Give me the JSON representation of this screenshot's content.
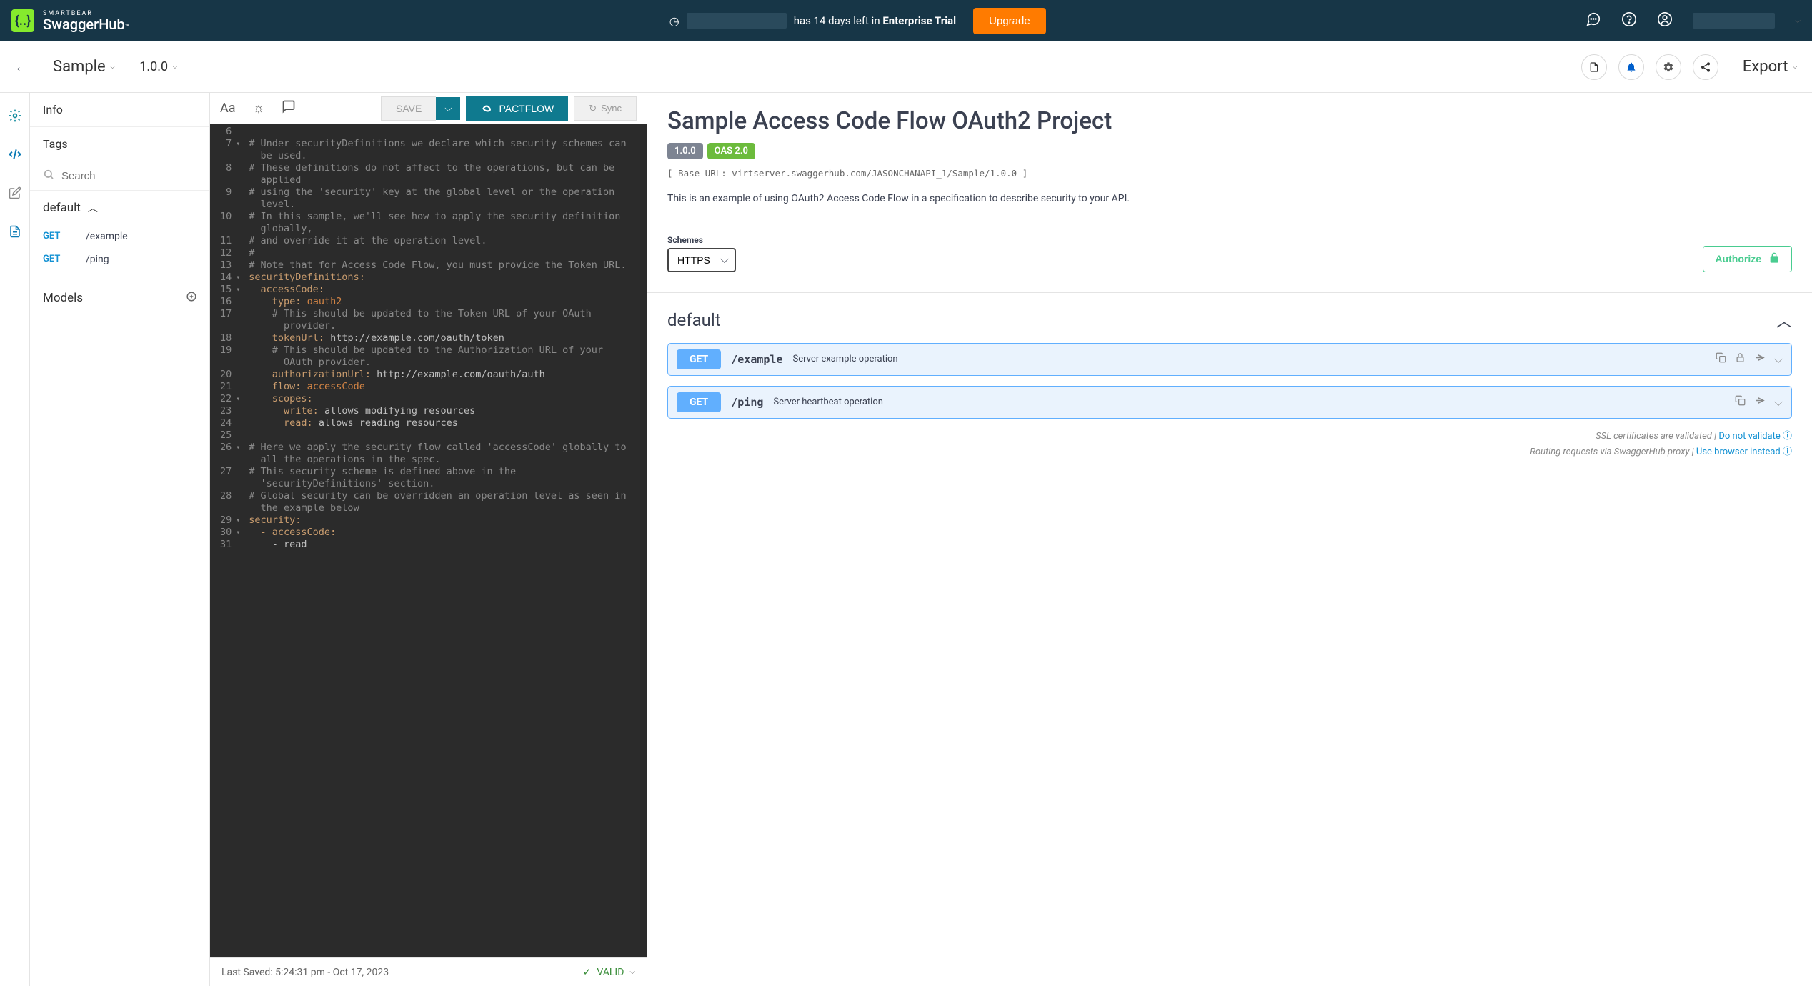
{
  "header": {
    "brand_small": "SMARTBEAR",
    "brand_big": "SwaggerHub",
    "trial_prefix": "has 14 days left in ",
    "trial_bold": "Enterprise Trial",
    "upgrade": "Upgrade"
  },
  "subheader": {
    "api_name": "Sample",
    "version": "1.0.0",
    "export": "Export"
  },
  "nav": {
    "info": "Info",
    "tags": "Tags",
    "search_placeholder": "Search",
    "group": "default",
    "endpoints": [
      {
        "method": "GET",
        "path": "/example"
      },
      {
        "method": "GET",
        "path": "/ping"
      }
    ],
    "models": "Models"
  },
  "editor_toolbar": {
    "save": "SAVE",
    "pactflow": "PACTFLOW",
    "sync": "Sync"
  },
  "editor_lines": [
    {
      "n": 6,
      "fold": false,
      "html": ""
    },
    {
      "n": 7,
      "fold": true,
      "html": "<span class='c-comment'># Under securityDefinitions we declare which security schemes can</span>"
    },
    {
      "n": "",
      "fold": false,
      "html": "<span class='c-comment'>  be used.</span>"
    },
    {
      "n": 8,
      "fold": false,
      "html": "<span class='c-comment'># These definitions do not affect to the operations, but can be</span>"
    },
    {
      "n": "",
      "fold": false,
      "html": "<span class='c-comment'>  applied</span>"
    },
    {
      "n": 9,
      "fold": false,
      "html": "<span class='c-comment'># using the 'security' key at the global level or the operation</span>"
    },
    {
      "n": "",
      "fold": false,
      "html": "<span class='c-comment'>  level.</span>"
    },
    {
      "n": 10,
      "fold": false,
      "html": "<span class='c-comment'># In this sample, we'll see how to apply the security definition</span>"
    },
    {
      "n": "",
      "fold": false,
      "html": "<span class='c-comment'>  globally,</span>"
    },
    {
      "n": 11,
      "fold": false,
      "html": "<span class='c-comment'># and override it at the operation level.</span>"
    },
    {
      "n": 12,
      "fold": false,
      "html": "<span class='c-comment'>#</span>"
    },
    {
      "n": 13,
      "fold": false,
      "html": "<span class='c-comment'># Note that for Access Code Flow, you must provide the Token URL.</span>"
    },
    {
      "n": 14,
      "fold": true,
      "html": "<span class='c-key'>securityDefinitions:</span>"
    },
    {
      "n": 15,
      "fold": true,
      "html": "  <span class='c-key'>accessCode:</span>"
    },
    {
      "n": 16,
      "fold": false,
      "html": "    <span class='c-key'>type:</span> <span class='c-keyword'>oauth2</span>"
    },
    {
      "n": 17,
      "fold": false,
      "html": "    <span class='c-comment'># This should be updated to the Token URL of your OAuth</span>"
    },
    {
      "n": "",
      "fold": false,
      "html": "    <span class='c-comment'>  provider.</span>"
    },
    {
      "n": 18,
      "fold": false,
      "html": "    <span class='c-key'>tokenUrl:</span> <span class='c-val'>http://example.com/oauth/token</span>"
    },
    {
      "n": 19,
      "fold": false,
      "html": "    <span class='c-comment'># This should be updated to the Authorization URL of your</span>"
    },
    {
      "n": "",
      "fold": false,
      "html": "    <span class='c-comment'>  OAuth provider.</span>"
    },
    {
      "n": 20,
      "fold": false,
      "html": "    <span class='c-key'>authorizationUrl:</span> <span class='c-val'>http://example.com/oauth/auth</span>"
    },
    {
      "n": 21,
      "fold": false,
      "html": "    <span class='c-key'>flow:</span> <span class='c-keyword'>accessCode</span>"
    },
    {
      "n": 22,
      "fold": true,
      "html": "    <span class='c-key'>scopes:</span>"
    },
    {
      "n": 23,
      "fold": false,
      "html": "      <span class='c-key'>write:</span> <span class='c-val'>allows modifying resources</span>"
    },
    {
      "n": 24,
      "fold": false,
      "html": "      <span class='c-key'>read:</span> <span class='c-val'>allows reading resources</span>"
    },
    {
      "n": 25,
      "fold": false,
      "html": ""
    },
    {
      "n": 26,
      "fold": true,
      "html": "<span class='c-comment'># Here we apply the security flow called 'accessCode' globally to</span>"
    },
    {
      "n": "",
      "fold": false,
      "html": "<span class='c-comment'>  all the operations in the spec.</span>"
    },
    {
      "n": 27,
      "fold": false,
      "html": "<span class='c-comment'># This security scheme is defined above in the</span>"
    },
    {
      "n": "",
      "fold": false,
      "html": "<span class='c-comment'>  'securityDefinitions' section.</span>"
    },
    {
      "n": 28,
      "fold": false,
      "html": "<span class='c-comment'># Global security can be overridden an operation level as seen in</span>"
    },
    {
      "n": "",
      "fold": false,
      "html": "<span class='c-comment'>  the example below</span>"
    },
    {
      "n": 29,
      "fold": true,
      "html": "<span class='c-key'>security:</span>"
    },
    {
      "n": 30,
      "fold": true,
      "html": "  <span class='c-key'>- accessCode:</span>"
    },
    {
      "n": 31,
      "fold": false,
      "html": "    <span class='c-val'>- read</span>"
    }
  ],
  "editor_status": {
    "saved": "Last Saved:  5:24:31 pm   -   Oct 17, 2023",
    "valid": "VALID"
  },
  "docs": {
    "title": "Sample Access Code Flow OAuth2 Project",
    "version_badge": "1.0.0",
    "oas_badge": "OAS 2.0",
    "base_url": "[ Base URL: virtserver.swaggerhub.com/JASONCHANAPI_1/Sample/1.0.0 ]",
    "description": "This is an example of using OAuth2 Access Code Flow in a specification to describe security to your API.",
    "schemes_label": "Schemes",
    "scheme": "HTTPS",
    "authorize": "Authorize",
    "tag": "default",
    "operations": [
      {
        "method": "GET",
        "path": "/example",
        "desc": "Server example operation",
        "icons": [
          "copy",
          "lock",
          "link",
          "chev"
        ]
      },
      {
        "method": "GET",
        "path": "/ping",
        "desc": "Server heartbeat operation",
        "icons": [
          "copy",
          "link",
          "chev"
        ]
      }
    ],
    "ssl_note": "SSL certificates are validated",
    "ssl_link": "Do not validate",
    "proxy_note": "Routing requests via SwaggerHub proxy",
    "proxy_link": "Use browser instead"
  }
}
